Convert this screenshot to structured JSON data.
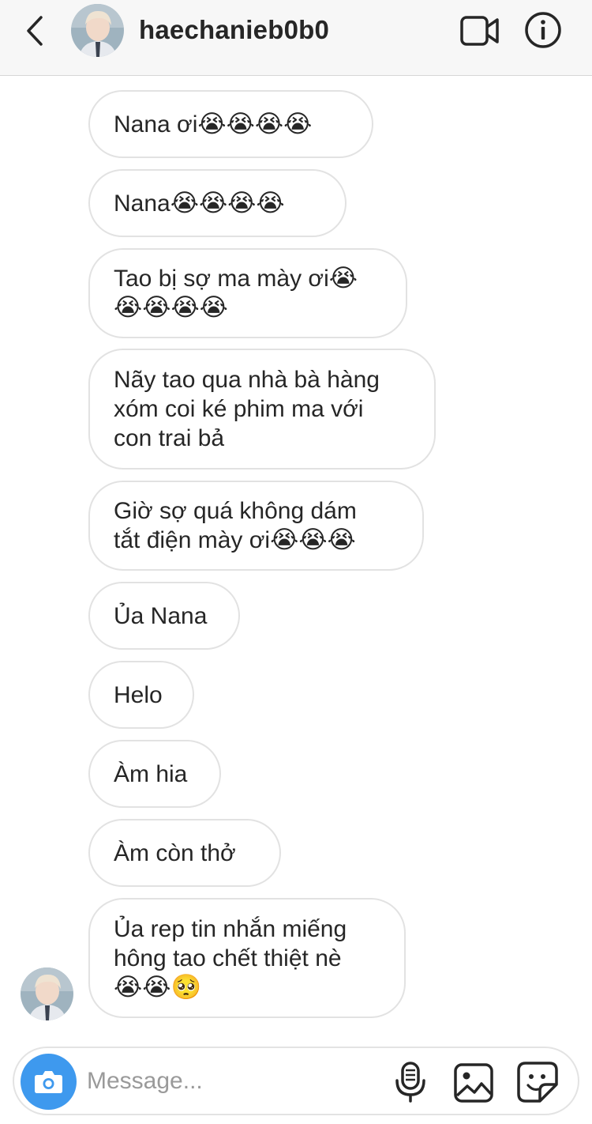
{
  "header": {
    "username": "haechanieb0b0",
    "back_icon": "chevron-left-icon",
    "video_icon": "video-call-icon",
    "info_icon": "info-icon"
  },
  "messages": [
    {
      "lines": [
        [
          "Nana ơi",
          "😭😭😭😭"
        ]
      ]
    },
    {
      "lines": [
        [
          "Nana",
          "😭😭😭😭"
        ]
      ]
    },
    {
      "lines": [
        [
          "Tao bị sợ ma mày ơi",
          "😭"
        ],
        [
          "",
          "😭😭😭😭"
        ]
      ]
    },
    {
      "lines": [
        [
          "Nãy tao qua nhà bà hàng",
          ""
        ],
        [
          "xóm coi ké phim ma với",
          ""
        ],
        [
          "con trai bả",
          ""
        ]
      ]
    },
    {
      "lines": [
        [
          "Giờ sợ quá không dám",
          ""
        ],
        [
          "tắt điện mày ơi",
          "😭😭😭"
        ]
      ]
    },
    {
      "lines": [
        [
          "Ủa Nana",
          ""
        ]
      ]
    },
    {
      "lines": [
        [
          "Helo",
          ""
        ]
      ]
    },
    {
      "lines": [
        [
          "Àm hia",
          ""
        ]
      ]
    },
    {
      "lines": [
        [
          "Àm còn thở",
          ""
        ]
      ]
    },
    {
      "lines": [
        [
          "Ủa rep tin nhắn miếng",
          ""
        ],
        [
          "hông tao chết thiệt nè",
          ""
        ],
        [
          "",
          "😭😭🥺"
        ]
      ]
    }
  ],
  "composer": {
    "placeholder": "Message...",
    "camera_icon": "camera-icon",
    "mic_icon": "microphone-icon",
    "gallery_icon": "gallery-icon",
    "sticker_icon": "sticker-icon"
  },
  "colors": {
    "header_bg": "#f7f7f7",
    "bubble_border": "#e2e2e2",
    "camera_button": "#3e99ee",
    "text": "#262626",
    "placeholder": "#9a9a9a"
  }
}
